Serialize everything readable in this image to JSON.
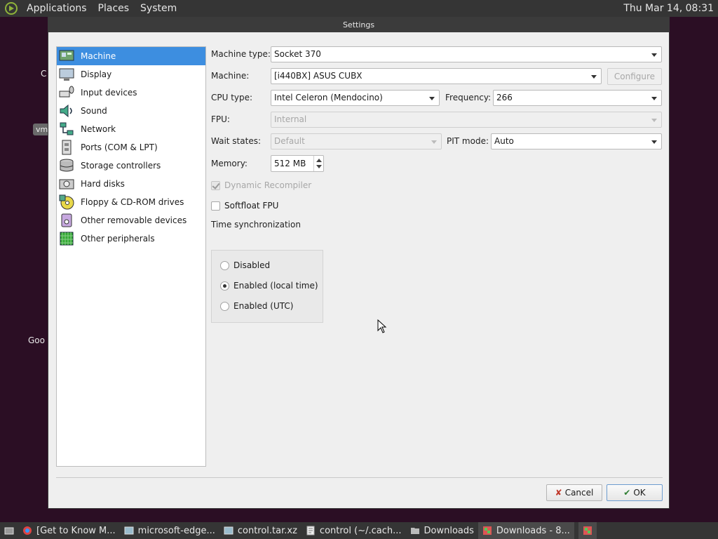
{
  "top_panel": {
    "menus": [
      "Applications",
      "Places",
      "System"
    ],
    "clock": "Thu Mar 14, 08:31"
  },
  "desktop": {
    "partial_labels": [
      "C",
      "vm",
      "Goo"
    ]
  },
  "dialog": {
    "title": "Settings",
    "sidebar": [
      {
        "label": "Machine",
        "icon": "machine-icon",
        "selected": true
      },
      {
        "label": "Display",
        "icon": "display-icon"
      },
      {
        "label": "Input devices",
        "icon": "input-devices-icon"
      },
      {
        "label": "Sound",
        "icon": "sound-icon"
      },
      {
        "label": "Network",
        "icon": "network-icon"
      },
      {
        "label": "Ports (COM & LPT)",
        "icon": "ports-icon"
      },
      {
        "label": "Storage controllers",
        "icon": "storage-controllers-icon"
      },
      {
        "label": "Hard disks",
        "icon": "hard-disks-icon"
      },
      {
        "label": "Floppy & CD-ROM drives",
        "icon": "floppy-cdrom-icon"
      },
      {
        "label": "Other removable devices",
        "icon": "removable-devices-icon"
      },
      {
        "label": "Other peripherals",
        "icon": "peripherals-icon"
      }
    ],
    "machine": {
      "machine_type_label": "Machine type:",
      "machine_type_value": "Socket 370",
      "machine_label": "Machine:",
      "machine_value": "[i440BX] ASUS CUBX",
      "configure_label": "Configure",
      "cpu_type_label": "CPU type:",
      "cpu_type_value": "Intel Celeron (Mendocino)",
      "frequency_label": "Frequency:",
      "frequency_value": "266",
      "fpu_label": "FPU:",
      "fpu_value": "Internal",
      "wait_states_label": "Wait states:",
      "wait_states_value": "Default",
      "pit_mode_label": "PIT mode:",
      "pit_mode_value": "Auto",
      "memory_label": "Memory:",
      "memory_value": "512 MB",
      "dynamic_recompiler_label": "Dynamic Recompiler",
      "dynamic_recompiler_checked": true,
      "softfloat_label": "Softfloat FPU",
      "softfloat_checked": false,
      "time_sync_label": "Time synchronization",
      "time_sync_options": [
        "Disabled",
        "Enabled (local time)",
        "Enabled (UTC)"
      ],
      "time_sync_selected": "Enabled (local time)"
    },
    "buttons": {
      "cancel_label": "Cancel",
      "ok_label": "OK"
    }
  },
  "taskbar": {
    "items": [
      {
        "label": "[Get to Know M...",
        "icon": "browser-icon"
      },
      {
        "label": "microsoft-edge...",
        "icon": "package-icon"
      },
      {
        "label": "control.tar.xz",
        "icon": "archive-icon"
      },
      {
        "label": "control (~/.cach...",
        "icon": "editor-icon"
      },
      {
        "label": "Downloads",
        "icon": "folder-icon"
      },
      {
        "label": "Downloads - 8...",
        "icon": "emulator-icon",
        "active": true
      }
    ]
  },
  "colors": {
    "selection": "#3d8ee0",
    "panel_bg": "#353535",
    "dialog_bg": "#efefef",
    "desktop_bg": "#2b0e24"
  }
}
